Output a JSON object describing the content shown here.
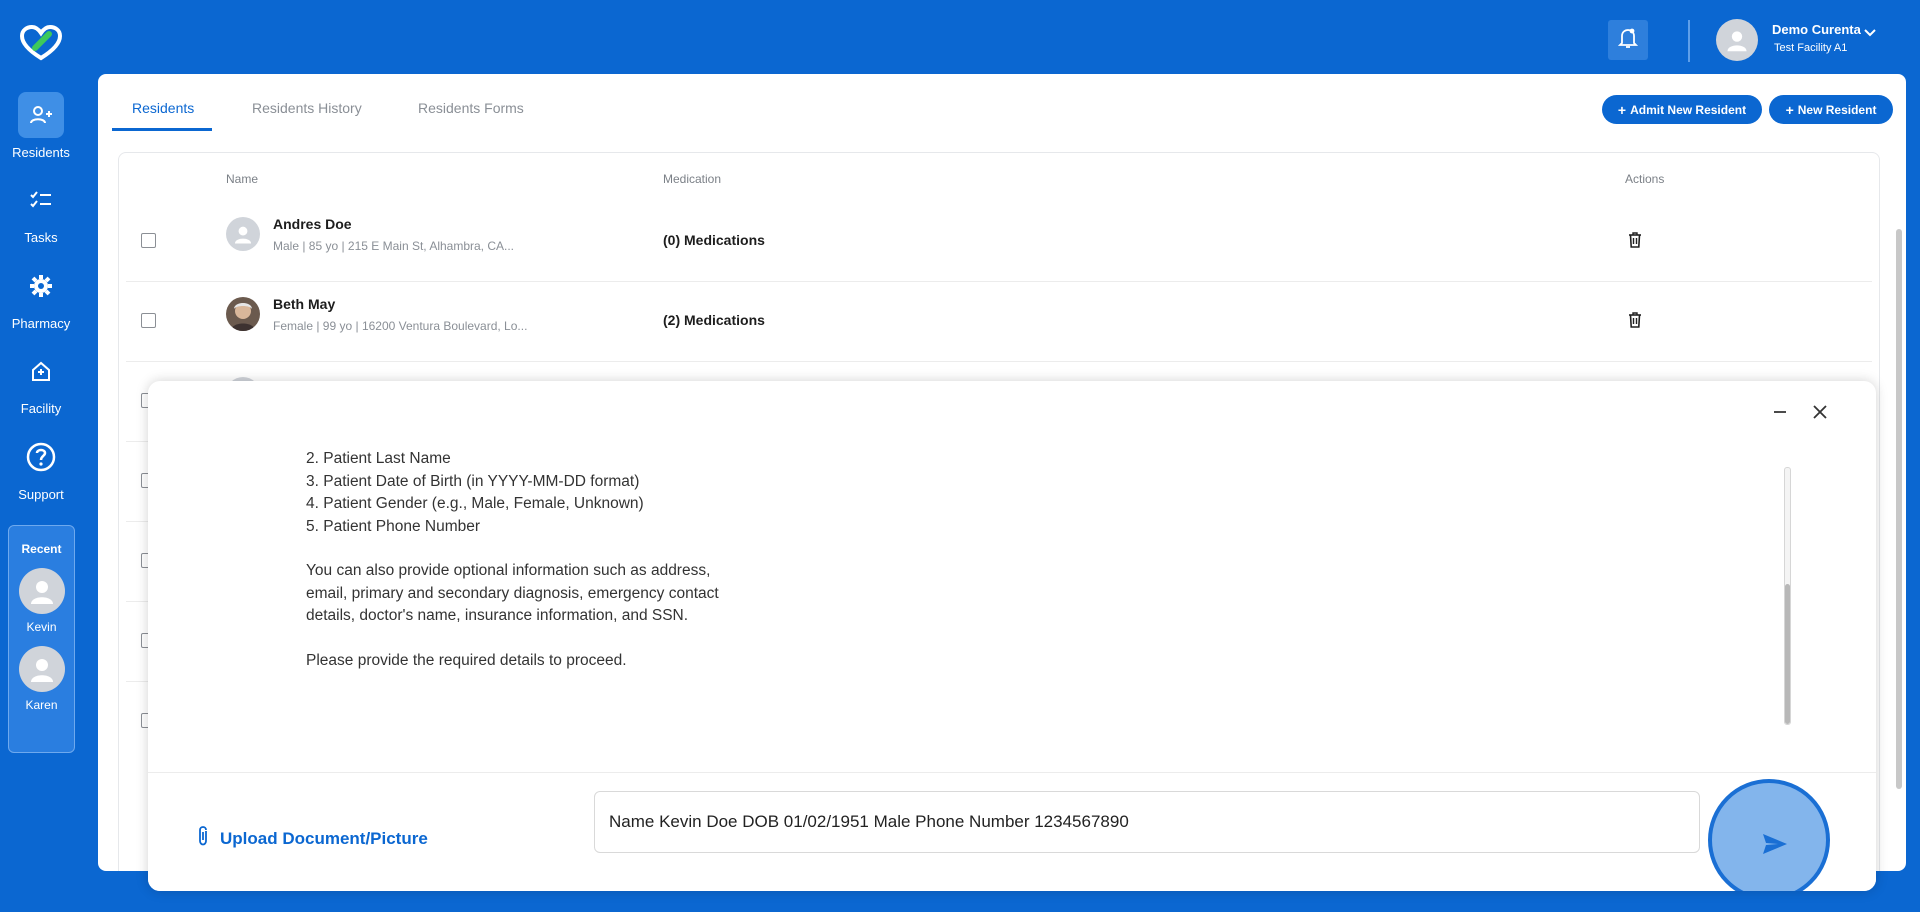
{
  "sidebar": {
    "items": [
      {
        "label": "Residents"
      },
      {
        "label": "Tasks"
      },
      {
        "label": "Pharmacy"
      },
      {
        "label": "Facility"
      },
      {
        "label": "Support"
      }
    ],
    "recent": {
      "title": "Recent",
      "people": [
        "Kevin",
        "Karen"
      ]
    }
  },
  "header": {
    "user_name": "Demo Curenta",
    "facility": "Test Facility A1"
  },
  "tabs": [
    "Residents",
    "Residents History",
    "Residents Forms"
  ],
  "actions": {
    "admit": "Admit New Resident",
    "new": "New Resident"
  },
  "table": {
    "headers": {
      "name": "Name",
      "medication": "Medication",
      "actions": "Actions"
    },
    "rows": [
      {
        "name": "Andres Doe",
        "sub": "Male | 85 yo | 215 E Main St, Alhambra, CA...",
        "meds": "(0) Medications"
      },
      {
        "name": "Beth May",
        "sub": "Female | 99 yo | 16200 Ventura Boulevard, Lo...",
        "meds": "(2) Medications"
      }
    ]
  },
  "chat": {
    "message_lines": [
      "2. Patient Last Name",
      "3. Patient Date of Birth (in YYYY-MM-DD format)",
      "4. Patient Gender (e.g., Male, Female, Unknown)",
      "5. Patient Phone Number",
      "",
      "You can also provide optional information such as address,",
      "email, primary and secondary diagnosis, emergency contact",
      "details, doctor's name, insurance information, and SSN.",
      "",
      "Please provide the required details to proceed."
    ],
    "upload_label": "Upload Document/Picture",
    "input_value": "Name Kevin Doe DOB 01/02/1951 Male Phone Number 1234567890"
  },
  "colors": {
    "brand": "#0b67d1",
    "accent": "#3f8fe6"
  }
}
